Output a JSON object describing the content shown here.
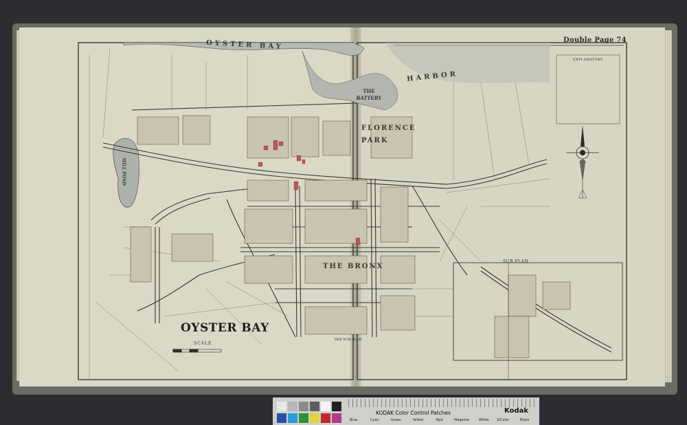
{
  "sheet": {
    "page_number_label": "Double Page 74",
    "town_title": "OYSTER BAY",
    "scale_label": "SCALE",
    "sub_plan_label": "SUB PLAN",
    "see_sub_plan_label": "SEE SUB PLAN"
  },
  "map_labels": {
    "water_oyster_bay": "OYSTER  BAY",
    "water_harbor": "HARBOR",
    "mill_pond": "MILL POND",
    "the_battery": "THE BATTERY",
    "florence_park": "FLORENCE PARK",
    "the_bronx": "THE BRONX"
  },
  "legend": {
    "title": "EXPLANATORY"
  },
  "kodak_target": {
    "title": "KODAK Color Control Patches",
    "brand": "Kodak",
    "patch_names": [
      "Blue",
      "Cyan",
      "Green",
      "Yellow",
      "Red",
      "Magenta",
      "White",
      "3/Color",
      "Black"
    ],
    "swatch_colors": [
      "#2a4fa8",
      "#2d9bd4",
      "#2f8f3a",
      "#e3d23a",
      "#c0282b",
      "#b03d8c",
      "#f2f2f2",
      "#5a4b40",
      "#111111"
    ]
  },
  "colors": {
    "paper": "#dcd8c6",
    "ink": "#3a372e",
    "water": "#aeb2ad",
    "brick": "#b85a5a"
  }
}
